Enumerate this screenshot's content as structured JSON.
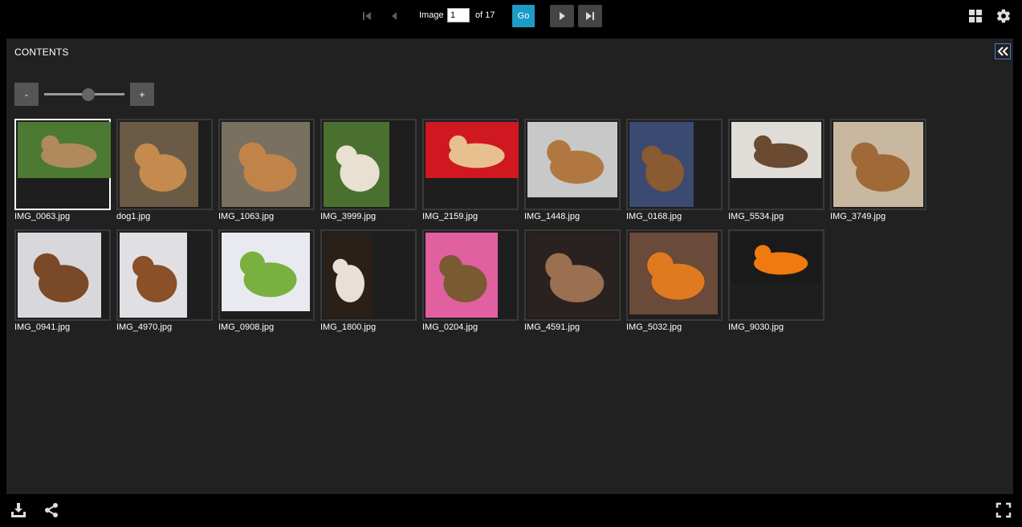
{
  "toolbar": {
    "image_label": "Image",
    "page_value": "1",
    "of_label": "of 17",
    "go_label": "Go"
  },
  "panel": {
    "title": "CONTENTS",
    "zoom_minus": "-",
    "zoom_plus": "+",
    "zoom_level": 0.55
  },
  "thumbnails": [
    {
      "caption": "IMG_0063.jpg",
      "colors": [
        "#4c7a32",
        "#b08a5a"
      ],
      "selected": true
    },
    {
      "caption": "dog1.jpg",
      "colors": [
        "#6b5a45",
        "#c48a4e"
      ]
    },
    {
      "caption": "IMG_1063.jpg",
      "colors": [
        "#7a7060",
        "#c08448"
      ]
    },
    {
      "caption": "IMG_3999.jpg",
      "colors": [
        "#4a7030",
        "#e8e0d0"
      ]
    },
    {
      "caption": "IMG_2159.jpg",
      "colors": [
        "#d01820",
        "#e8c090"
      ]
    },
    {
      "caption": "IMG_1448.jpg",
      "colors": [
        "#c8c8c8",
        "#b07840"
      ]
    },
    {
      "caption": "IMG_0168.jpg",
      "colors": [
        "#3a4a70",
        "#8a5a30"
      ]
    },
    {
      "caption": "IMG_5534.jpg",
      "colors": [
        "#e0dcd8",
        "#6a4a30"
      ]
    },
    {
      "caption": "IMG_3749.jpg",
      "colors": [
        "#c8b8a0",
        "#a06a38"
      ]
    },
    {
      "caption": "IMG_0941.jpg",
      "colors": [
        "#d8d8dc",
        "#7a4a28"
      ]
    },
    {
      "caption": "IMG_4970.jpg",
      "colors": [
        "#e0e0e4",
        "#8a5028"
      ]
    },
    {
      "caption": "IMG_0908.jpg",
      "colors": [
        "#e8eaf0",
        "#7ab040"
      ]
    },
    {
      "caption": "IMG_1800.jpg",
      "colors": [
        "#2a2018",
        "#e8e0d8"
      ]
    },
    {
      "caption": "IMG_0204.jpg",
      "colors": [
        "#e060a0",
        "#7a5a30"
      ]
    },
    {
      "caption": "IMG_4591.jpg",
      "colors": [
        "#2a2220",
        "#9a7050"
      ]
    },
    {
      "caption": "IMG_5032.jpg",
      "colors": [
        "#6a4a38",
        "#e07a20"
      ]
    },
    {
      "caption": "IMG_9030.jpg",
      "colors": [
        "#1a1a1a",
        "#f07a10"
      ]
    }
  ]
}
